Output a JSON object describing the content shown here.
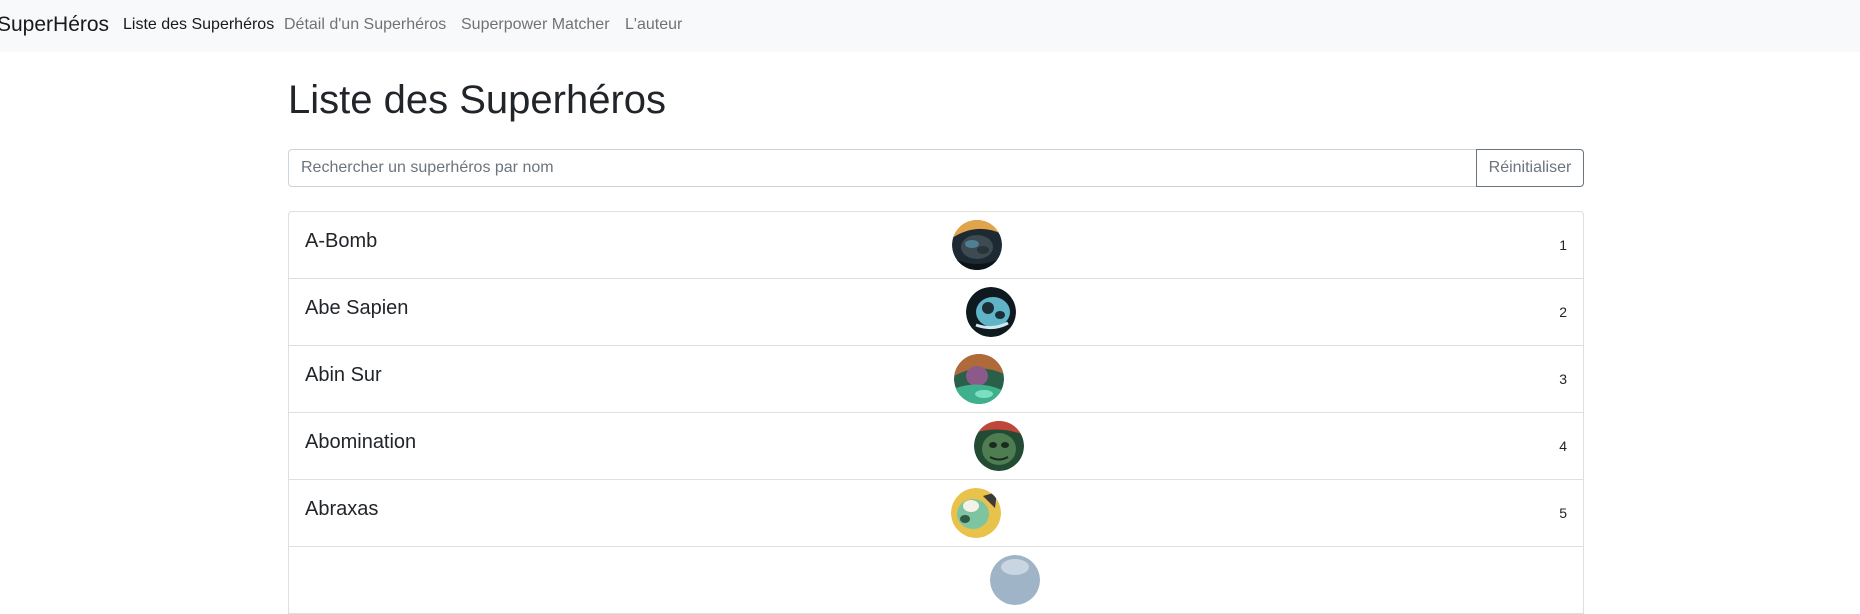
{
  "navbar": {
    "brand": "SuperHéros",
    "links": [
      {
        "label": "Liste des Superhéros",
        "active": true
      },
      {
        "label": "Détail d'un Superhéros",
        "active": false
      },
      {
        "label": "Superpower Matcher",
        "active": false
      },
      {
        "label": "L'auteur",
        "active": false
      }
    ]
  },
  "page": {
    "title": "Liste des Superhéros"
  },
  "search": {
    "placeholder": "Rechercher un superhéros par nom",
    "value": "",
    "reset_label": "Réinitialiser"
  },
  "heroes": [
    {
      "name": "A-Bomb",
      "id": "1"
    },
    {
      "name": "Abe Sapien",
      "id": "2"
    },
    {
      "name": "Abin Sur",
      "id": "3"
    },
    {
      "name": "Abomination",
      "id": "4"
    },
    {
      "name": "Abraxas",
      "id": "5"
    },
    {
      "name": "",
      "id": ""
    }
  ]
}
